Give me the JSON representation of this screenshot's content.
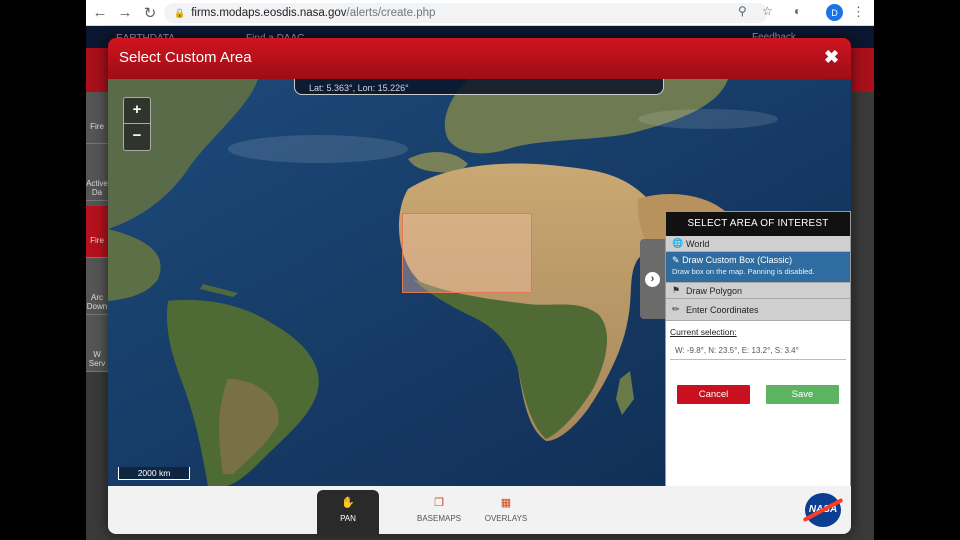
{
  "browser": {
    "url_host": "firms.modaps.eosdis.nasa.gov",
    "url_path": "/alerts/create.php",
    "profile_initial": "D"
  },
  "site": {
    "brand": "EARTHDATA",
    "nav_text": "Find a DAAC",
    "feedback": "Feedback",
    "sidebar": [
      {
        "label": "Fire"
      },
      {
        "label": "Active Da"
      },
      {
        "label": "Fire"
      },
      {
        "label": "Arc Down"
      },
      {
        "label": "W Serv"
      }
    ]
  },
  "modal": {
    "title": "Select Custom Area",
    "close_icon": "close-icon"
  },
  "map": {
    "coordinates": "Lat: 5.363°, Lon: 15.226°",
    "zoom_in": "+",
    "zoom_out": "−",
    "scale": "2000 km"
  },
  "aoi_panel": {
    "heading": "SELECT AREA OF INTEREST",
    "options": {
      "world": "World",
      "draw_box": "Draw Custom Box (Classic)",
      "draw_box_hint": "Draw box on the map. Panning is disabled.",
      "draw_polygon": "Draw Polygon",
      "enter_coords": "Enter Coordinates"
    },
    "current_selection_label": "Current selection:",
    "current_selection_value": "W: -9.8°, N: 23.5°, E: 13.2°, S: 3.4°",
    "cancel": "Cancel",
    "save": "Save"
  },
  "toolbar": {
    "pan": "PAN",
    "basemaps": "BASEMAPS",
    "overlays": "OVERLAYS",
    "logo_text": "NASA"
  },
  "colors": {
    "header_red": "#c8101e",
    "selected_blue": "#2f6da0",
    "save_green": "#5cb462"
  }
}
